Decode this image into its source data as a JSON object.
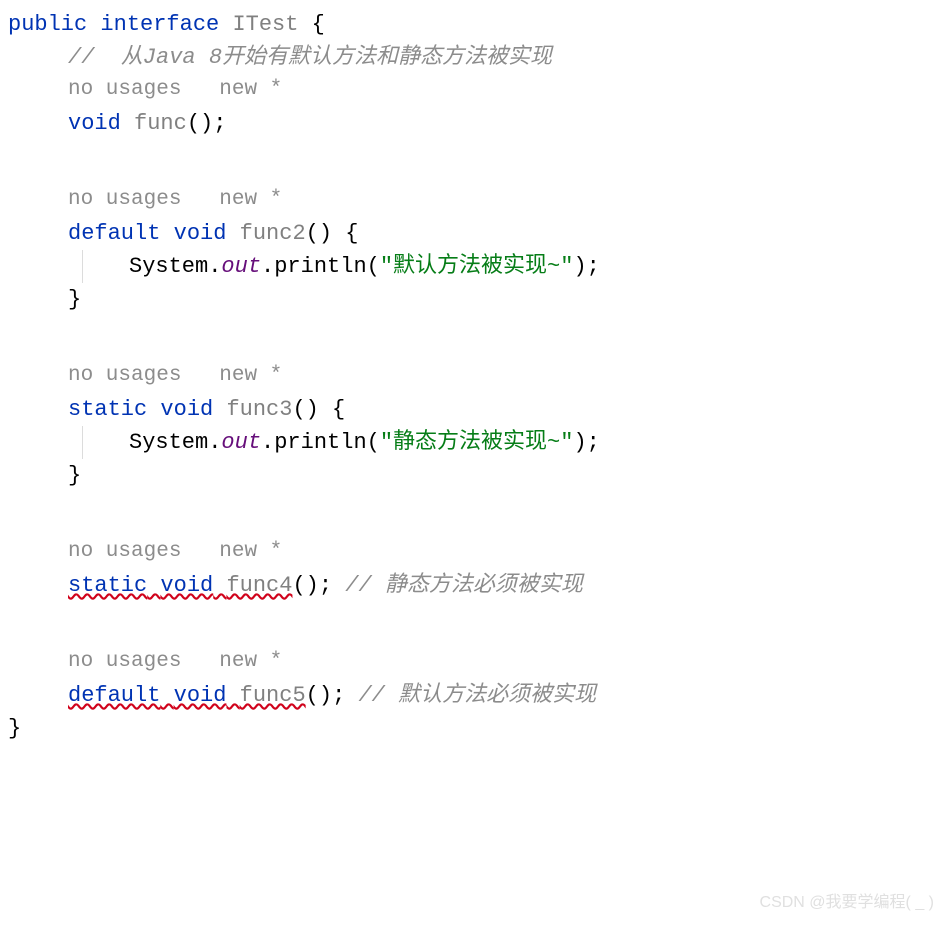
{
  "code": {
    "line1": {
      "public": "public",
      "interface": "interface",
      "classname": "ITest",
      "brace": " {"
    },
    "comment1": "//  从Java 8开始有默认方法和静态方法被实现",
    "hint1": {
      "usages": "no usages",
      "author": "new *"
    },
    "func1": {
      "void": "void",
      "name": "func",
      "paren": "()",
      "semi": ";"
    },
    "hint2": {
      "usages": "no usages",
      "author": "new *"
    },
    "func2_decl": {
      "default": "default",
      "void": "void",
      "name": "func2",
      "paren": "()",
      "brace": " {"
    },
    "func2_body": {
      "system": "System",
      "dot1": ".",
      "out": "out",
      "dot2": ".",
      "println": "println",
      "lparen": "(",
      "str": "\"默认方法被实现~\"",
      "rparen": ")",
      "semi": ";"
    },
    "func2_close": "}",
    "hint3": {
      "usages": "no usages",
      "author": "new *"
    },
    "func3_decl": {
      "static": "static",
      "void": "void",
      "name": "func3",
      "paren": "()",
      "brace": " {"
    },
    "func3_body": {
      "system": "System",
      "dot1": ".",
      "out": "out",
      "dot2": ".",
      "println": "println",
      "lparen": "(",
      "str": "\"静态方法被实现~\"",
      "rparen": ")",
      "semi": ";"
    },
    "func3_close": "}",
    "hint4": {
      "usages": "no usages",
      "author": "new *"
    },
    "func4": {
      "static": "static",
      "void": "void",
      "name": "func4",
      "paren": "()",
      "semi": ";",
      "comment": " // 静态方法必须被实现"
    },
    "hint5": {
      "usages": "no usages",
      "author": "new *"
    },
    "func5": {
      "default": "default",
      "void": "void",
      "name": "func5",
      "paren": "()",
      "semi": ";",
      "comment": " // 默认方法必须被实现"
    },
    "close_brace": "}"
  },
  "watermark": "CSDN @我要学编程( _ )"
}
